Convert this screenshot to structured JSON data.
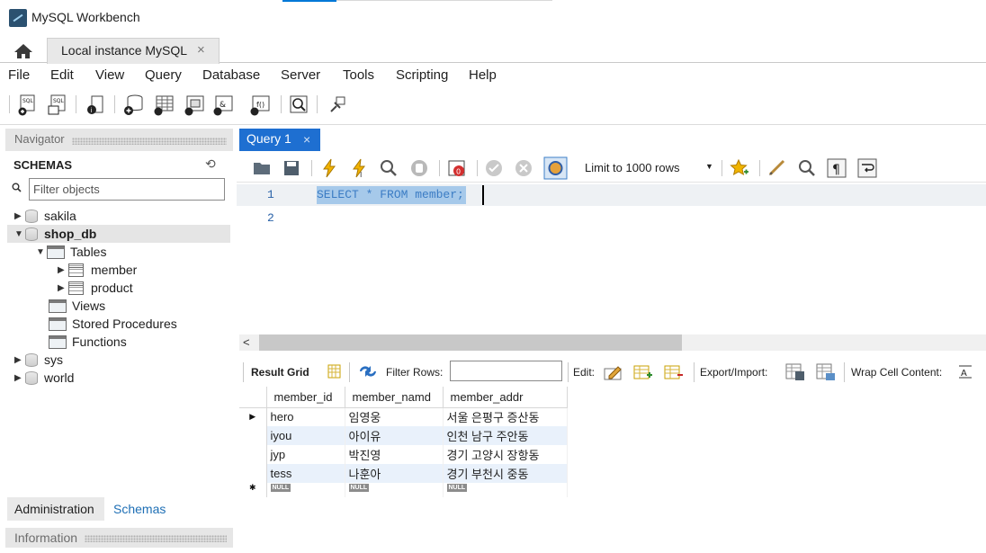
{
  "window": {
    "title": "MySQL Workbench"
  },
  "tabs": {
    "home_icon": "home-icon",
    "instance_label": "Local instance MySQL",
    "close_glyph": "×"
  },
  "menu": [
    "File",
    "Edit",
    "View",
    "Query",
    "Database",
    "Server",
    "Tools",
    "Scripting",
    "Help"
  ],
  "navigator": {
    "header": "Navigator",
    "schemas_title": "SCHEMAS",
    "filter_placeholder": "Filter objects",
    "tree": {
      "sakila": "sakila",
      "shop_db": "shop_db",
      "tables": "Tables",
      "member": "member",
      "product": "product",
      "views": "Views",
      "stored_procedures": "Stored Procedures",
      "functions": "Functions",
      "sys": "sys",
      "world": "world"
    },
    "bottom_tabs": {
      "administration": "Administration",
      "schemas": "Schemas"
    },
    "info_header": "Information"
  },
  "query": {
    "tab_label": "Query 1",
    "close_glyph": "×",
    "limit": "Limit to 1000 rows",
    "lines": [
      "1",
      "2"
    ],
    "sql": "SELECT * FROM member;"
  },
  "result": {
    "result_grid_label": "Result Grid",
    "filter_rows_label": "Filter Rows:",
    "edit_label": "Edit:",
    "export_label": "Export/Import:",
    "wrap_label": "Wrap Cell Content:",
    "columns": [
      "member_id",
      "member_namd",
      "member_addr"
    ],
    "rows": [
      [
        "hero",
        "임영웅",
        "서울 은평구 증산동"
      ],
      [
        "iyou",
        "아이유",
        "인천 남구 주안동"
      ],
      [
        "jyp",
        "박진영",
        "경기 고양시 장항동"
      ],
      [
        "tess",
        "나훈아",
        "경기 부천시 중동"
      ]
    ],
    "null_label": "NULL"
  }
}
